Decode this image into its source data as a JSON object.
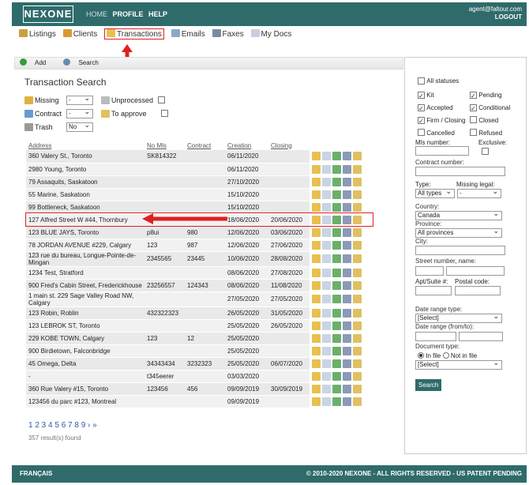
{
  "brand": "NEXONE",
  "nav": {
    "home": "HOME",
    "profile": "PROFILE",
    "help": "HELP"
  },
  "user": {
    "email": "agent@faltour.com",
    "logout": "LOGOUT"
  },
  "subnav": [
    "Listings",
    "Clients",
    "Transactions",
    "Emails",
    "Faxes",
    "My Docs"
  ],
  "toolbar": {
    "add": "Add",
    "search": "Search"
  },
  "title": "Transaction Search",
  "filters": {
    "missing": "Missing",
    "missing_val": "-",
    "unprocessed": "Unprocessed",
    "contract": "Contract",
    "contract_val": "-",
    "to_approve": "To approve",
    "trash": "Trash",
    "trash_val": "No"
  },
  "columns": [
    "Address",
    "No Mls",
    "Contract",
    "Creation",
    "Closing"
  ],
  "rows": [
    [
      "360 Valery St., Toronto",
      "SK814322",
      "",
      "06/11/2020",
      ""
    ],
    [
      "2980 Young, Toronto",
      "",
      "",
      "06/11/2020",
      ""
    ],
    [
      "79 Assaquits, Saskatoon",
      "",
      "",
      "27/10/2020",
      ""
    ],
    [
      "55 Marine, Saskatoon",
      "",
      "",
      "15/10/2020",
      ""
    ],
    [
      "99 Bottleneck, Saskatoon",
      "",
      "",
      "15/10/2020",
      ""
    ],
    [
      "127 Alfred Street W #44, Thornbury",
      "",
      "",
      "18/06/2020",
      "20/06/2020"
    ],
    [
      "123 BLUE JAYS, Toronto",
      "p8ui",
      "980",
      "12/06/2020",
      "03/06/2020"
    ],
    [
      "78 JORDAN AVENUE #229, Calgary",
      "123",
      "987",
      "12/06/2020",
      "27/06/2020"
    ],
    [
      "123 rue du bureau, Longue-Pointe-de-Mingan",
      "2345565",
      "23445",
      "10/06/2020",
      "28/08/2020"
    ],
    [
      "1234 Test, Stratford",
      "",
      "",
      "08/06/2020",
      "27/08/2020"
    ],
    [
      "900 Fred's Cabin Street, Frederickhouse",
      "23256557",
      "124343",
      "08/06/2020",
      "11/08/2020"
    ],
    [
      "1 main st. 229 Sage Valley Road NW, Calgary",
      "",
      "",
      "27/05/2020",
      "27/05/2020"
    ],
    [
      "123 Robin, Roblin",
      "432322323",
      "",
      "26/05/2020",
      "31/05/2020"
    ],
    [
      "123 LEBROK ST, Toronto",
      "",
      "",
      "25/05/2020",
      "26/05/2020"
    ],
    [
      "229 KOBE TOWN, Calgary",
      "123",
      "12",
      "25/05/2020",
      ""
    ],
    [
      "900 Birdietown, Falconbridge",
      "",
      "",
      "25/05/2020",
      ""
    ],
    [
      "45 Omega, Delta",
      "34343434",
      "3232323",
      "25/05/2020",
      "06/07/2020"
    ],
    [
      "-",
      "t345eerer",
      "",
      "03/03/2020",
      ""
    ],
    [
      "360 Rue Valery #15, Toronto",
      "123456",
      "456",
      "09/09/2019",
      "30/09/2019"
    ],
    [
      "123456 du parc #123, Montreal",
      "",
      "",
      "09/09/2019",
      ""
    ]
  ],
  "pager": "1 2 3 4 5 6 7 8 9 › »",
  "results": "357 result(s) found",
  "sidebar": {
    "all_statuses": "All statuses",
    "kit": "Kit",
    "pending": "Pending",
    "accepted": "Accepted",
    "conditional": "Conditional",
    "firm": "Firm / Closing",
    "closed": "Closed",
    "cancelled": "Cancelled",
    "refused": "Refused",
    "mls_number": "Mls number:",
    "exclusive": "Exclusive:",
    "contract_number": "Contract number:",
    "type": "Type:",
    "missing_legal": "Missing legal:",
    "type_val": "All types",
    "missing_val": "-",
    "country": "Country:",
    "country_val": "Canada",
    "province": "Province:",
    "province_val": "All provinces",
    "city": "City:",
    "street": "Street number, name:",
    "apt": "Apt/Suite #:",
    "postal": "Postal code:",
    "date_type": "Date range type:",
    "date_type_val": "[Select]",
    "date_range": "Date range (from/to):",
    "doc_type": "Document type:",
    "in_file": "In file",
    "not_in_file": "Not in file",
    "doc_val": "[Select]",
    "search_btn": "Search"
  },
  "footer": {
    "lang": "FRANÇAIS",
    "copy": "© 2010-2020 NEXONE - ALL RIGHTS RESERVED - US PATENT PENDING"
  },
  "colors": {
    "brand": "#2f6b6b",
    "highlight": "#e02020"
  }
}
